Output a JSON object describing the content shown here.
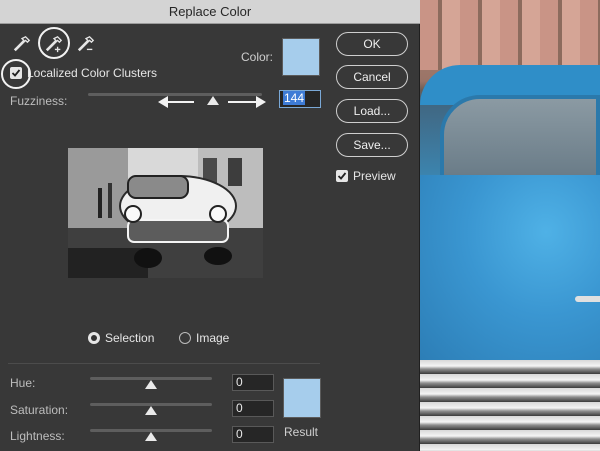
{
  "dialog": {
    "title": "Replace Color",
    "color_label": "Color:",
    "localized_label": "Localized Color Clusters",
    "fuzziness_label": "Fuzziness:",
    "fuzziness_value": "144",
    "fuzziness_fraction": 0.72,
    "selection_label": "Selection",
    "image_label": "Image",
    "selected_mode": "selection",
    "swatch_color": "#a6cdec"
  },
  "buttons": {
    "ok": "OK",
    "cancel": "Cancel",
    "load": "Load...",
    "save": "Save...",
    "preview_label": "Preview"
  },
  "replacement": {
    "hue_label": "Hue:",
    "hue_value": "0",
    "saturation_label": "Saturation:",
    "saturation_value": "0",
    "lightness_label": "Lightness:",
    "lightness_value": "0",
    "result_label": "Result",
    "result_color": "#a6cdec"
  },
  "icons": {
    "tool_1": "eyedropper-icon",
    "tool_2": "eyedropper-plus-icon",
    "tool_3": "eyedropper-minus-icon"
  }
}
